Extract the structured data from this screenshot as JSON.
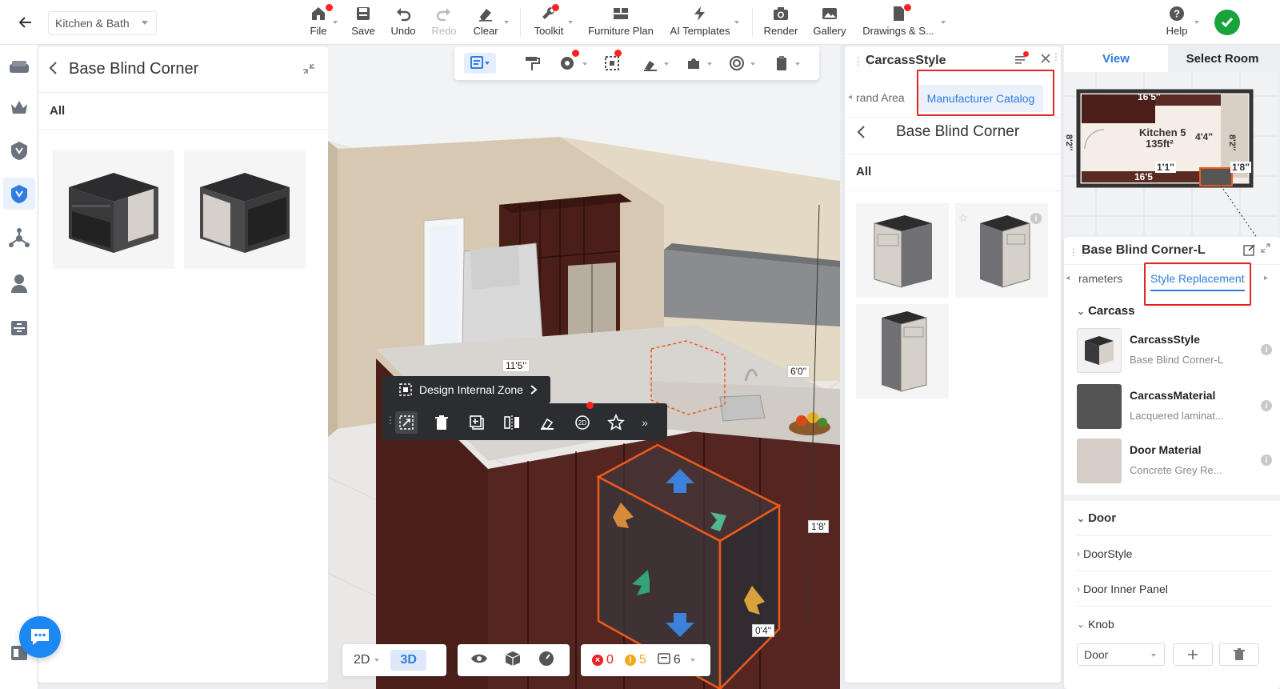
{
  "app": {
    "project_name": "Kitchen & Bath"
  },
  "toolbar": {
    "file": "File",
    "save": "Save",
    "undo": "Undo",
    "redo": "Redo",
    "clear": "Clear",
    "toolkit": "Toolkit",
    "furniture_plan": "Furniture Plan",
    "ai_templates": "AI Templates",
    "render": "Render",
    "gallery": "Gallery",
    "drawings": "Drawings & S...",
    "help": "Help"
  },
  "catalog": {
    "title": "Base Blind Corner",
    "filter": "All"
  },
  "viewport": {
    "context_zone_label": "Design Internal Zone",
    "view_mode_2d": "2D",
    "view_mode_3d": "3D",
    "error_count": "0",
    "warning_count": "5",
    "item_count": "6",
    "dimensions": {
      "d1": "11'5''",
      "d2": "6'0''",
      "d3": "1'8'",
      "d4": "0'4''"
    }
  },
  "carcass_panel": {
    "title": "CarcassStyle",
    "tab_partial": "rand Area",
    "tab_active": "Manufacturer Catalog",
    "subtitle": "Base Blind Corner",
    "filter": "All"
  },
  "right_panel": {
    "tab_view": "View",
    "tab_select_room": "Select Room",
    "minimap": {
      "room_name": "Kitchen 5",
      "room_area": "135ft²",
      "dim_top": "16'5''",
      "dim_left": "8'2''",
      "dim_right": "8'2''",
      "dim_inner": "4'4''",
      "dim_bottom": "16'5",
      "dim_small": "1'1''",
      "dim_side": "1'8''"
    },
    "props_title": "Base Blind Corner-L",
    "props_tab_partial": "rameters",
    "props_tab_active": "Style Replacement",
    "section_carcass": "Carcass",
    "materials": [
      {
        "name": "CarcassStyle",
        "value": "Base Blind Corner-L"
      },
      {
        "name": "CarcassMaterial",
        "value": "Lacquered laminat..."
      },
      {
        "name": "Door Material",
        "value": "Concrete Grey Re..."
      }
    ],
    "sections": [
      "Door",
      "DoorStyle",
      "Door Inner Panel",
      "Knob"
    ],
    "knob_select": "Door"
  },
  "colors": {
    "accent": "#1c6fe0",
    "highlight_red": "#e62222",
    "cabinet_dark": "#4a1f1a",
    "selection_orange": "#f05a1a",
    "success_green": "#19a33b"
  }
}
